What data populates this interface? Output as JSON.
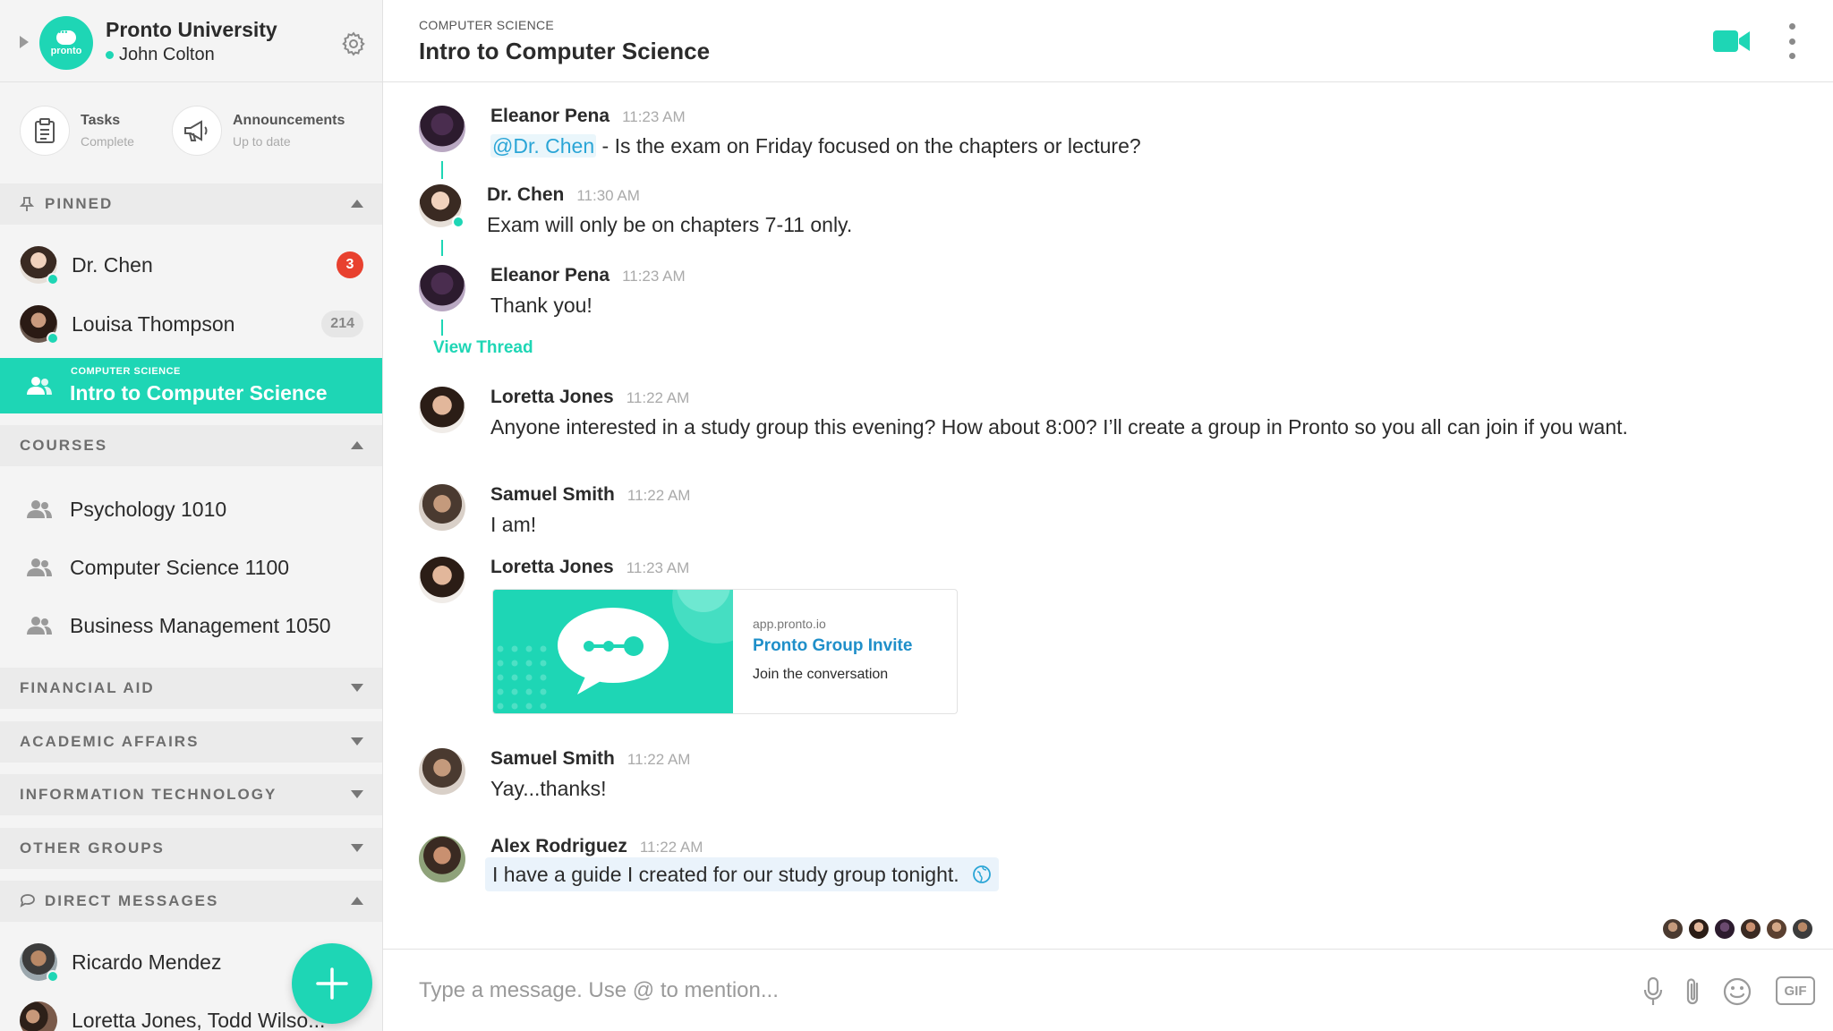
{
  "org": {
    "name": "Pronto University",
    "logo_word": "pronto",
    "user": "John Colton"
  },
  "quick": [
    {
      "title": "Tasks",
      "status": "Complete",
      "icon": "clipboard-icon"
    },
    {
      "title": "Announcements",
      "status": "Up to date",
      "icon": "megaphone-icon"
    }
  ],
  "sections": {
    "pinned": "PINNED",
    "courses": "COURSES",
    "financial_aid": "FINANCIAL AID",
    "academic_affairs": "ACADEMIC AFFAIRS",
    "information_technology": "INFORMATION TECHNOLOGY",
    "other_groups": "OTHER GROUPS",
    "direct_messages": "DIRECT MESSAGES"
  },
  "pinned": [
    {
      "name": "Dr. Chen",
      "badge": "3"
    },
    {
      "name": "Louisa Thompson",
      "badge": "214"
    }
  ],
  "active_channel": {
    "category": "COMPUTER SCIENCE",
    "name": "Intro to Computer Science"
  },
  "courses": [
    "Psychology 1010",
    "Computer Science 1100",
    "Business Management 1050"
  ],
  "direct_messages": [
    "Ricardo Mendez",
    "Loretta Jones, Todd Wilso..."
  ],
  "channel": {
    "category": "COMPUTER SCIENCE",
    "title": "Intro to Computer Science"
  },
  "messages": [
    {
      "author": "Eleanor Pena",
      "time": "11:23 AM",
      "mention": "@Dr. Chen",
      "text": " - Is the exam on Friday focused on the chapters or lecture?"
    },
    {
      "author": "Dr. Chen",
      "time": "11:30 AM",
      "text": "Exam will only be on chapters 7-11 only."
    },
    {
      "author": "Eleanor Pena",
      "time": "11:23 AM",
      "text": "Thank you!"
    },
    {
      "author": "Loretta Jones",
      "time": "11:22 AM",
      "text": "Anyone interested in a study group this evening? How about 8:00? I’ll create a group in Pronto so you all can join if you want."
    },
    {
      "author": "Samuel Smith",
      "time": "11:22 AM",
      "text": "I am!"
    },
    {
      "author": "Loretta Jones",
      "time": "11:23 AM",
      "text": ""
    },
    {
      "author": "Samuel Smith",
      "time": "11:22 AM",
      "text": "Yay...thanks!"
    },
    {
      "author": "Alex Rodriguez",
      "time": "11:22 AM",
      "text": "I have a guide I created for our study group tonight."
    }
  ],
  "view_thread": "View Thread",
  "link_card": {
    "domain": "app.pronto.io",
    "title": "Pronto Group Invite",
    "description": "Join the conversation"
  },
  "composer": {
    "placeholder": "Type a message. Use @ to mention...",
    "gif_label": "GIF"
  },
  "colors": {
    "accent": "#1ed6b5",
    "badge_red": "#e8412f",
    "link_blue": "#1f8fc9",
    "mention_blue": "#2aa5d6"
  }
}
